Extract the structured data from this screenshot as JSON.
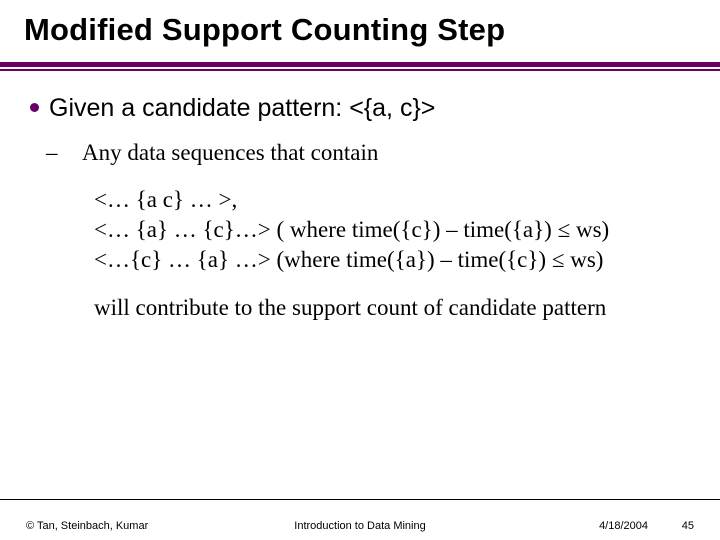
{
  "title": "Modified Support Counting Step",
  "bullet1": "Given a candidate pattern: <{a, c}>",
  "sub1": "Any data sequences that contain",
  "lines": {
    "l1": "<… {a c} … >,",
    "l2": "<… {a} … {c}…>   ( where time({c}) – time({a}) ≤ ws)",
    "l3": "<…{c} … {a} …>   (where time({a}) – time({c}) ≤ ws)"
  },
  "closing": "will contribute to the support count of candidate pattern",
  "footer": {
    "left": "© Tan, Steinbach, Kumar",
    "mid": "Introduction to Data Mining",
    "date": "4/18/2004",
    "page": "45"
  }
}
